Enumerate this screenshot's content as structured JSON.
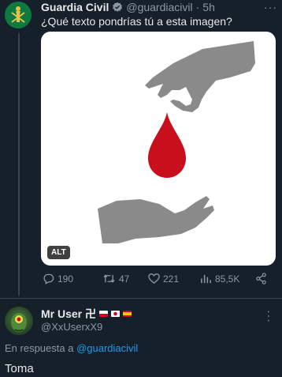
{
  "original_tweet": {
    "author_name": "Guardia Civil",
    "handle": "@guardiacivil",
    "separator": "·",
    "time": "5h",
    "text": "¿Qué texto pondrías tú a esta imagen?",
    "verified_icon": "verified-badge-icon",
    "media": {
      "alt_badge": "ALT",
      "drop_color": "#c8101c",
      "hand_color": "#8a8a8a"
    },
    "metrics": {
      "replies": "190",
      "retweets": "47",
      "likes": "221",
      "views": "85,5K"
    }
  },
  "reply_tweet": {
    "author_name": "Mr User 卍",
    "handle": "@XxUserxX9",
    "in_reply_prefix": "En respuesta a",
    "in_reply_mention": "@guardiacivil",
    "text": "Toma"
  },
  "colors": {
    "background": "#15202b",
    "accent": "#1d9bf0",
    "muted": "#8b98a5",
    "verified": "#8b98a5"
  }
}
